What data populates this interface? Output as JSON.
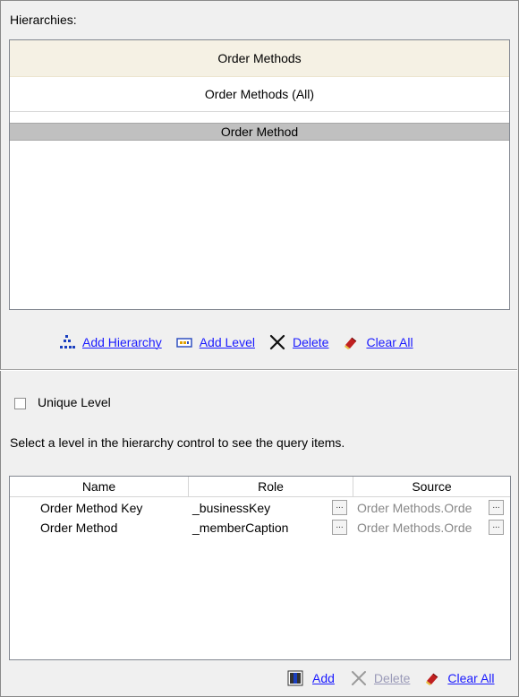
{
  "hierarchies": {
    "caption": "Hierarchies:",
    "header": "Order Methods",
    "all_member": "Order Methods (All)",
    "level": "Order Method"
  },
  "hier_toolbar": {
    "add_hierarchy": "Add Hierarchy",
    "add_level": "Add Level",
    "delete": "Delete",
    "clear_all": "Clear All"
  },
  "unique_level": {
    "label": "Unique Level",
    "checked": false
  },
  "info_text": "Select a level in the hierarchy control to see the query items.",
  "grid": {
    "columns": [
      "Name",
      "Role",
      "Source"
    ],
    "rows": [
      {
        "name": "Order Method Key",
        "role": "_businessKey",
        "source": "Order Methods.Order Method Key"
      },
      {
        "name": "Order Method",
        "role": "_memberCaption",
        "source": "Order Methods.Order Method"
      }
    ],
    "ellipsis": "..."
  },
  "grid_toolbar": {
    "add": "Add",
    "delete": "Delete",
    "clear_all": "Clear All"
  },
  "colors": {
    "link": "#1a1aff",
    "disabled_link": "#9a9ab8",
    "header_bg": "#f5f1e4",
    "selected_level": "#c0c0c0"
  }
}
